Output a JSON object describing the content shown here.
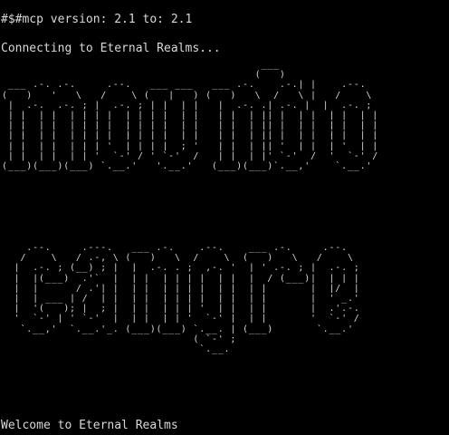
{
  "terminal": {
    "header_text": "#$#mcp version: 2.1 to: 2.1",
    "connecting_text": "Connecting to Eternal Realms...",
    "welcome_text": "Welcome to Eternal Realms",
    "colors": {
      "background": "#000000",
      "text": "#d8d8d8"
    },
    "banner_top": "                                          ___\n                                         (   )\n ___ .-. .-.     .--.   ___ ___   ___ .-.    .-.| |    .--.\n(   )   '   \\   /    \\ (   |   ) (   )   \\  /   \\ |   /    \\\n |  .-.  .-. ; |  .-. ; | |  | |   |  .-. .| .-. |  |  .-. ;\n | |  | |  | | | |  | | | |  | |   | |  | || |  | |  | |  | |\n | |  | |  | | | |  | | | |  | |   | |  | || |  | |  | |  | |\n | |  | |  | | | |  | | | |  | |   | |  | || |  | |  | |  | |\n | |  | |  | | | '  | | | |  ; '   | |  | || '  | |  | '  | |\n | |  | |  | | '  `-' / ' `-'  /   | |  | |' `-'  /  '  `-' /\n(___)(___)(___) `.__.'   '.__.'   (___)(___)`.__,'    `.__.'",
    "banner_bottom": "    .--.     .---.   ___ .-.    .--.    ___ .-.     .--.\n   /    \\   / .-, \\ (   )   \\  /    \\  (   )   \\   /    \\\n  |  .-. ; (__) ; |  |  .-. . ;  ,-. '  | ' .-. ; |  .-. ;\n  |  |(___)  .'`  |  | |  | | | |  | |  |  / (___)|  | | |\n  |  |      / .'| |  | |  | | | |  | |  | |       |  |/  |\n  |  | ___ | /  | |  | |  | | | |  | |  | |       |  ' _.'\n  |  '(   ); |  ; |  | |  | | | '  | |  | |       |  .'.-.\n  '  `-' | ' `-'  |  | |  | | '  `-' |  | |       '  `-' /\n   `.__,'  `.__.'_. (___)(___) `.__. | (___)       `.__.'\n                               ( `-' ;\n                                `.__."
  }
}
